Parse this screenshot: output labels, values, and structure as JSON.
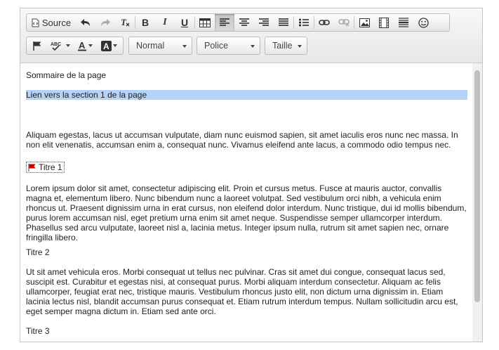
{
  "toolbar": {
    "source_label": "Source",
    "format_label": "Normal",
    "font_label": "Police",
    "size_label": "Taille"
  },
  "content": {
    "toc_title": "Sommaire de la page",
    "toc_link": "Lien vers la section 1 de la page",
    "para1": "Aliquam egestas, lacus ut accumsan vulputate, diam nunc euismod sapien, sit amet iaculis eros nunc nec massa. In non elit venenatis, accumsan enim a, consequat nunc. Vivamus eleifend ante lacus, a commodo odio tempus nec.",
    "anchor_title": "Titre 1",
    "para2": "Lorem ipsum dolor sit amet, consectetur adipiscing elit. Proin et cursus metus. Fusce at mauris auctor, convallis magna et, elementum libero. Nunc bibendum nunc a laoreet volutpat. Sed vestibulum orci nibh, a vehicula enim rhoncus ut. Praesent dignissim urna in erat cursus, non eleifend dolor interdum. Nunc tristique, dui id mollis bibendum, purus lorem accumsan nisl, eget pretium urna enim sit amet neque. Suspendisse semper ullamcorper interdum. Phasellus sed arcu vulputate, laoreet nisl a, lacinia metus. Integer ipsum nulla, rutrum sit amet sapien nec, ornare fringilla libero.",
    "title2": "Titre 2",
    "para3": "Ut sit amet vehicula eros. Morbi consequat ut tellus nec pulvinar. Cras sit amet dui congue, consequat lacus sed, suscipit est. Curabitur et egestas nisi, at consequat purus. Morbi aliquam interdum consectetur. Aliquam ac felis ullamcorper, feugiat erat nec, tristique mauris. Vestibulum rhoncus justo elit, non dictum urna dignissim in. Etiam lacinia lectus nisl, blandit accumsan purus consequat et. Etiam rutrum interdum tempus. Nullam sollicitudin arcu est, eget semper magna dictum in. Etiam sed ante orci.",
    "title3": "Titre 3"
  },
  "colors": {
    "selection": "#b4d3f7",
    "anchor_flag": "#cc0000"
  }
}
